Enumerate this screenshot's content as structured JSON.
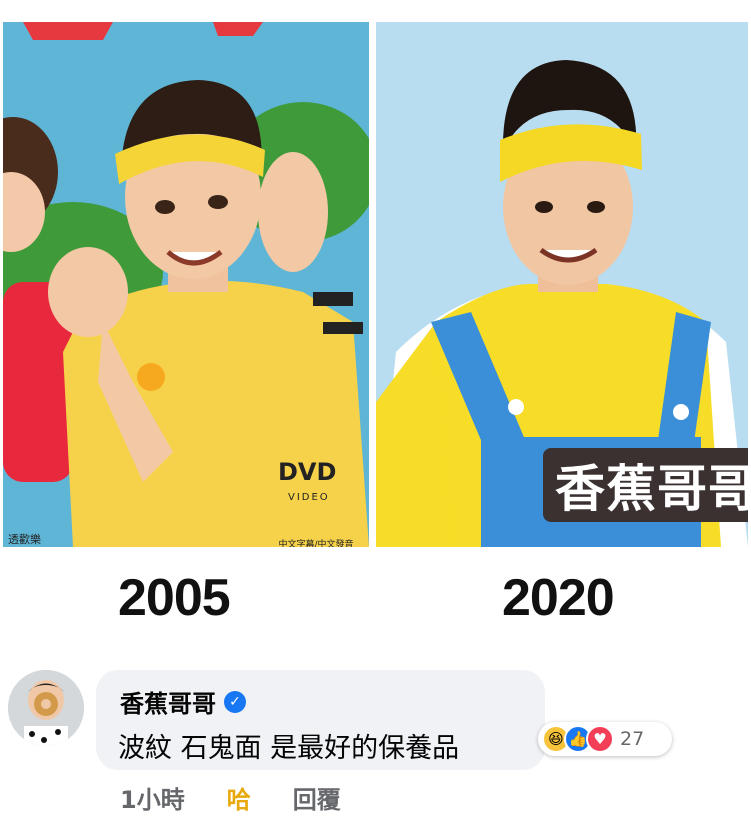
{
  "photos": {
    "left": {
      "year": "2005",
      "dvd_logo": "DVD",
      "dvd_sub": "VIDEO",
      "dvd_caption": "中文字幕/中文發音",
      "corner_text": "透歡樂"
    },
    "right": {
      "year": "2020",
      "name_stamp": "香蕉哥哥"
    }
  },
  "comment": {
    "author": "香蕉哥哥",
    "verified_icon": "verified-check-icon",
    "text": "波紋 石鬼面 是最好的保養品",
    "reactions": {
      "icons": [
        "haha-reaction-icon",
        "like-reaction-icon",
        "love-reaction-icon"
      ],
      "count": "27"
    },
    "actions": {
      "time": "1小時",
      "reaction": "哈",
      "reply": "回覆"
    }
  },
  "colors": {
    "facebook_blue": "#1877f2",
    "haha_yellow": "#e8a90c",
    "bubble_bg": "#f0f2f5"
  }
}
